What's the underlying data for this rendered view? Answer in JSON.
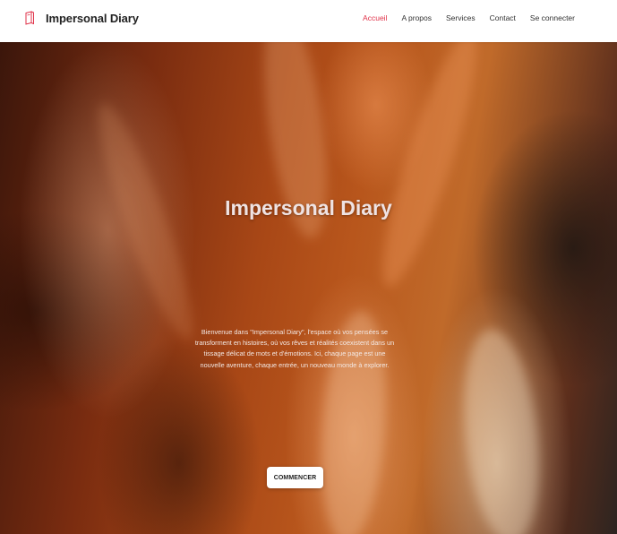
{
  "brand": {
    "name": "Impersonal Diary",
    "icon": "book-icon",
    "icon_color": "#e0334a"
  },
  "nav": {
    "items": [
      {
        "label": "Accueil",
        "active": true
      },
      {
        "label": "A propos",
        "active": false
      },
      {
        "label": "Services",
        "active": false
      },
      {
        "label": "Contact",
        "active": false
      },
      {
        "label": "Se connecter",
        "active": false
      }
    ],
    "active_color": "#e0334a"
  },
  "hero": {
    "title": "Impersonal Diary",
    "description": "Bienvenue dans \"Impersonal Diary\", l'espace où vos pensées se transforment en histoires, où vos rêves et réalités coexistent dans un tissage délicat de mots et d'émotions. Ici, chaque page est une nouvelle aventure, chaque entrée, un nouveau monde à explorer.",
    "cta_label": "COMMENCER"
  }
}
